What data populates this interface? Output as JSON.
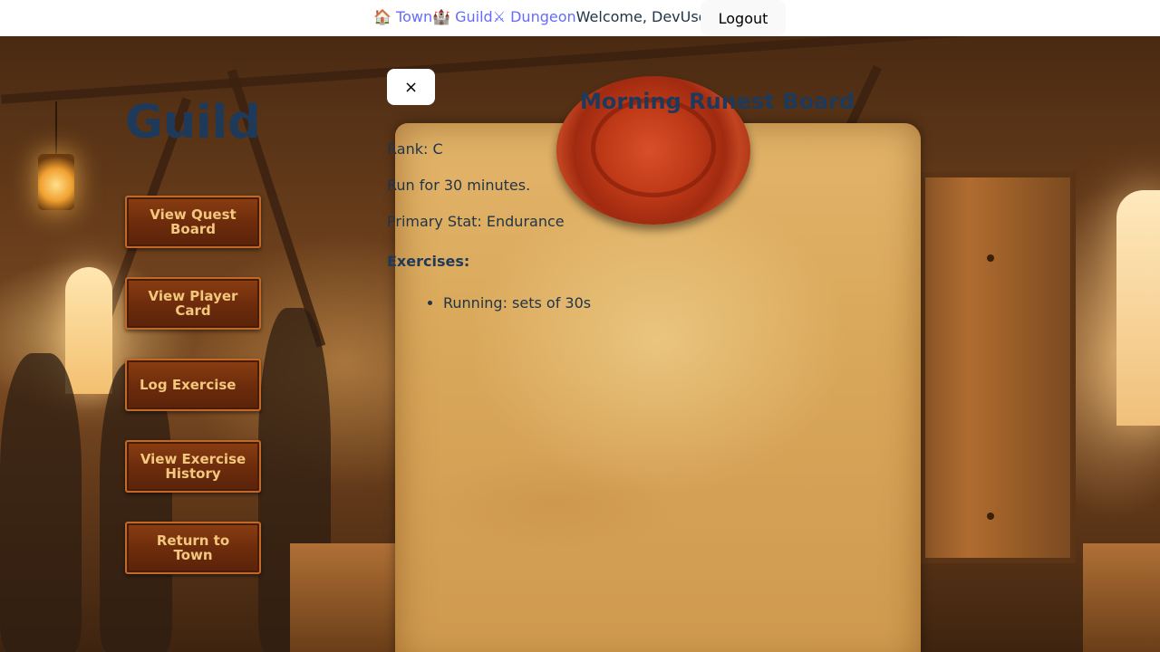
{
  "nav": {
    "town_link": "🏠 Town",
    "guild_link": "🏰 Guild",
    "dungeon_link": "⚔ Dungeon",
    "welcome": "Welcome, DevUser!",
    "logout_label": "Logout"
  },
  "guild": {
    "title": "Guild",
    "buttons": [
      {
        "label": "View Quest Board"
      },
      {
        "label": "View Player Card"
      },
      {
        "label": "Log Exercise"
      },
      {
        "label": "View Exercise History"
      },
      {
        "label": "Return to Town"
      }
    ]
  },
  "quest": {
    "close_label": "×",
    "title": "Morning Runest Board",
    "rank": "Rank: C",
    "description": "Run for 30 minutes.",
    "primary_stat": "Primary Stat: Endurance",
    "exercises_heading": "Exercises:",
    "exercises": [
      "Running: sets of 30s"
    ]
  },
  "colors": {
    "nav_link": "#646cff",
    "heading": "#1e3a5a",
    "button_text": "#f3c77c",
    "seal": "#c03a18"
  }
}
